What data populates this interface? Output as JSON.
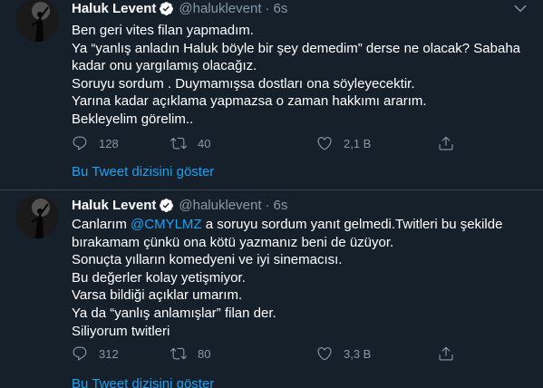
{
  "colors": {
    "background": "#15202b",
    "text": "#ffffff",
    "secondary_text": "#8899a6",
    "accent": "#1da1f2",
    "divider": "#38444d"
  },
  "tweets": [
    {
      "author_name": "Haluk Levent",
      "verified_icon": "verified-badge-icon",
      "handle": "@haluklevent",
      "separator": "·",
      "time": "6s",
      "lines": [
        "Ben geri vites filan yapmadım.",
        "Ya “yanlış anladın Haluk böyle bir şey demedim” derse ne olacak? Sabaha",
        "kadar onu yargılamış olacağız.",
        "Soruyu sordum . Duymamışsa dostları ona söyleyecektir.",
        "Yarına kadar açıklama yapmazsa o zaman hakkımı ararım.",
        "Bekleyelim görelim.."
      ],
      "reply_count": "128",
      "retweet_count": "40",
      "like_count": "2,1 B",
      "show_thread": "Bu Tweet dizisini göster"
    },
    {
      "author_name": "Haluk Levent",
      "verified_icon": "verified-badge-icon",
      "handle": "@haluklevent",
      "separator": "·",
      "time": "6s",
      "line1_before": "Canlarım ",
      "line1_mention": "@CMYLMZ",
      "line1_after": " a soruyu sordum yanıt gelmedi.Twitleri bu şekilde",
      "lines": [
        "bırakamam çünkü ona kötü yazmanız beni de üzüyor.",
        "Sonuçta yılların komedyeni ve iyi sinemacısı.",
        "Bu değerler kolay yetişmiyor.",
        "Varsa bildiği açıklar umarım.",
        "Ya da “yanlış anlamışlar” filan der.",
        "Siliyorum twitleri"
      ],
      "reply_count": "312",
      "retweet_count": "80",
      "like_count": "3,3 B",
      "show_thread": "Bu Tweet dizisini göster"
    }
  ]
}
